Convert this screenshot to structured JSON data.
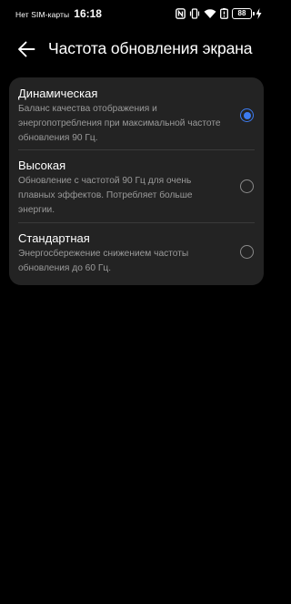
{
  "status_bar": {
    "carrier": "Нет SIM-карты",
    "time": "16:18",
    "battery_level": "88",
    "icons": [
      "nfc-icon",
      "vibrate-icon",
      "wifi-icon",
      "battery-saver-icon",
      "battery-icon",
      "charging-bolt-icon"
    ]
  },
  "header": {
    "back_icon": "back-arrow-icon",
    "title": "Частота обновления экрана"
  },
  "options": [
    {
      "title": "Динамическая",
      "description": "Баланс качества отображения и энергопотребления при максимальной частоте обновления 90 Гц.",
      "selected": true
    },
    {
      "title": "Высокая",
      "description": "Обновление с частотой 90 Гц для очень плавных эффектов. Потребляет больше энергии.",
      "selected": false
    },
    {
      "title": "Стандартная",
      "description": "Энергосбережение снижением частоты обновления до 60 Гц.",
      "selected": false
    }
  ],
  "colors": {
    "background": "#000000",
    "card": "#232323",
    "accent": "#3c7bf0",
    "secondary_text": "#9a9a9a"
  }
}
